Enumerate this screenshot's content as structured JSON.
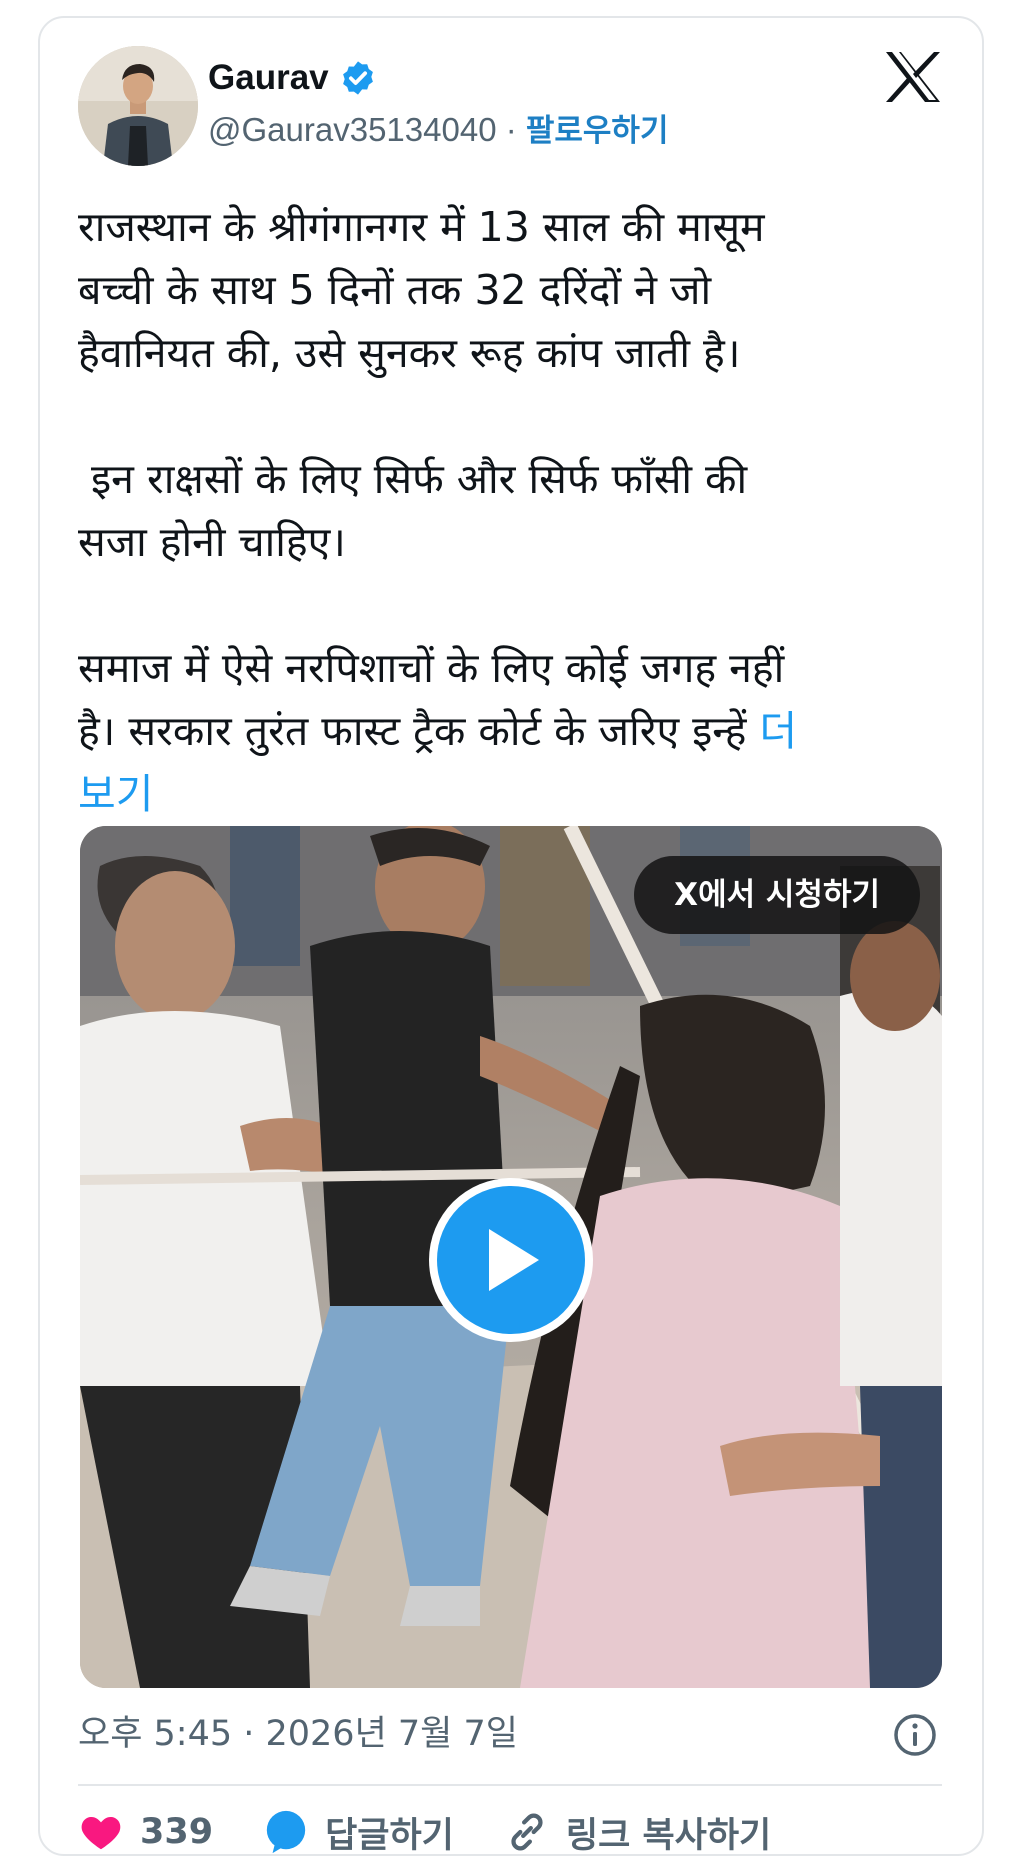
{
  "author": {
    "display_name": "Gaurav",
    "handle": "@Gaurav35134040",
    "separator": " · ",
    "follow_label": "팔로우하기"
  },
  "tweet": {
    "text": "राजस्थान के श्रीगंगानगर में 13 साल की मासूम\nबच्ची के साथ 5 दिनों तक 32 दरिंदों ने जो\nहैवानियत की, उसे सुनकर रूह कांप जाती है।\n\n इन राक्षसों के लिए सिर्फ और सिर्फ फाँसी की\nसजा होनी चाहिए।\n\nसमाज में ऐसे नरपिशाचों के लिए कोई जगह नहीं\nहै। सरकार तुरंत फास्ट ट्रैक कोर्ट के जरिए इन्हें ",
    "more_label": "더\n보기"
  },
  "media": {
    "watch_label": "X에서 시청하기"
  },
  "meta": {
    "timestamp": "오후 5:45 · 2026년 7월 7일"
  },
  "actions": {
    "like_count": "339",
    "reply_label": "답글하기",
    "copy_link_label": "링크 복사하기"
  },
  "icons": {
    "verified": "verified-badge-icon",
    "brand": "x-logo-icon",
    "play": "play-icon",
    "info": "info-icon",
    "like": "heart-icon",
    "reply": "reply-bubble-icon",
    "link": "link-icon"
  },
  "colors": {
    "accent": "#1d9bf0",
    "link": "#1d7fc4",
    "muted": "#536471",
    "like": "#f91880"
  }
}
